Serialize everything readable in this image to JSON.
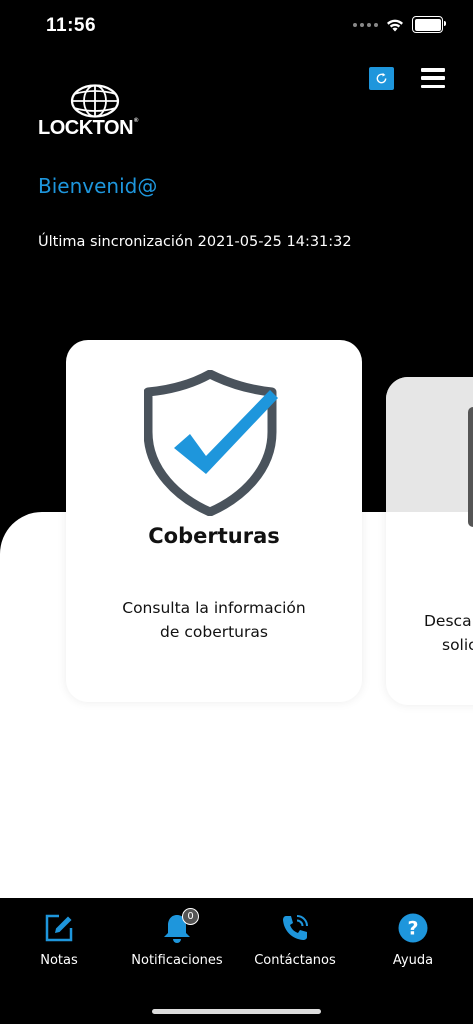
{
  "status_bar": {
    "time": "11:56"
  },
  "header": {
    "logo_text": "LOCKTON",
    "logo_mark": "®",
    "welcome": "Bienvenid@",
    "last_sync": "Última sincronización 2021-05-25 14:31:32",
    "icons": {
      "refresh": "refresh-icon",
      "menu": "hamburger-menu-icon"
    }
  },
  "cards": [
    {
      "title": "Coberturas",
      "description_line1": "Consulta la información",
      "description_line2": "de coberturas",
      "icon": "shield-check-icon"
    },
    {
      "description_line1": "Descar",
      "description_line2": "solic"
    }
  ],
  "tab_bar": {
    "items": [
      {
        "label": "Notas",
        "icon": "edit-note-icon"
      },
      {
        "label": "Notificaciones",
        "icon": "bell-icon",
        "badge": "0"
      },
      {
        "label": "Contáctanos",
        "icon": "phone-icon"
      },
      {
        "label": "Ayuda",
        "icon": "help-icon"
      }
    ]
  },
  "colors": {
    "accent": "#1e96dc",
    "background": "#000000",
    "shield_gray": "#4a535c"
  }
}
